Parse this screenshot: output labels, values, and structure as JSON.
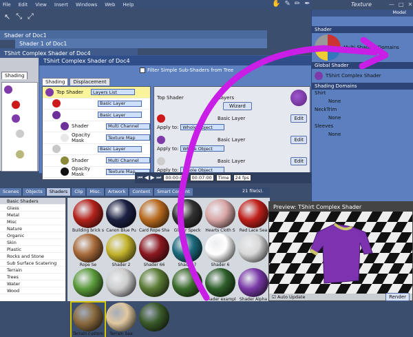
{
  "menu": [
    "File",
    "Edit",
    "View",
    "Insert",
    "Windows",
    "Web",
    "Help"
  ],
  "texture_label": "Texture",
  "model_label": "Model",
  "windows": {
    "doc1": "Shader of Doc1",
    "doc1_sub": "Shader 1 of Doc1",
    "tshirt_bg": "TShirt Complex Shader of Doc4",
    "main_title": "TShirt Complex Shader of Doc4",
    "left_tab": "Shading"
  },
  "filter_label": "Filter Simple Sub-Shaders from Tree",
  "tabs": [
    "Shading",
    "Displacement"
  ],
  "tree_rows": [
    {
      "label": "Top Shader",
      "dd": "Layers List",
      "color": "#7e3aa8",
      "selected": true
    },
    {
      "label": "",
      "dd": "Basic Layer",
      "color": "#cc1a1a"
    },
    {
      "label": "",
      "dd": "Basic Layer",
      "color": "#6e2f9a"
    },
    {
      "label": "Shader",
      "dd": "Multi Channel",
      "color": "#6e2f9a"
    },
    {
      "label": "Opacity Mask",
      "dd": "Texture Map",
      "color": "#e8e8e8"
    },
    {
      "label": "",
      "dd": "Basic Layer",
      "color": "#c8c8c8"
    },
    {
      "label": "Shader",
      "dd": "Multi Channel",
      "color": "#8a8a3a"
    },
    {
      "label": "Opacity Mask",
      "dd": "Texture Map",
      "color": "#111111"
    }
  ],
  "right_pane": {
    "top_shader": "Top Shader",
    "layers": "Layers",
    "wizard": "Wizard",
    "basic_layer": "Basic Layer",
    "apply_to": "Apply to:",
    "whole_object": "Whole Object",
    "edit": "Edit"
  },
  "timeline": {
    "start": "00:00:00",
    "end": "00:07:00",
    "time": "Time",
    "fps": "24 fps"
  },
  "content_tabs": [
    "Scenes",
    "Objects",
    "Shaders",
    "Clip",
    "Misc.",
    "Artwork",
    "Content",
    "Smart Content"
  ],
  "files_count": "21 file(s).",
  "categories": [
    "Basic Shaders",
    "Glass",
    "Metal",
    "Misc",
    "Nature",
    "Organic",
    "Skin",
    "Plastic",
    "Rocks and Stone",
    "Sub Surface Scatering",
    "Terrain",
    "Trees",
    "Water",
    "Wood"
  ],
  "tiles": [
    {
      "cap": "Building brick s",
      "color": "#b3221b"
    },
    {
      "cap": "Canon Blue Pu",
      "color": "#1c2142"
    },
    {
      "cap": "Card Rope Sha",
      "color": "#b86a1e"
    },
    {
      "cap": "Glitter Speck",
      "color": "#333"
    },
    {
      "cap": "Hearts Cloth S",
      "color": "#d9a6a6"
    },
    {
      "cap": "Red Lace Sea",
      "color": "#c0201b"
    },
    {
      "cap": "Rope Se",
      "color": "#a86a3a"
    },
    {
      "cap": "Shader 2",
      "color": "#c2b22b"
    },
    {
      "cap": "Shader 66",
      "color": "#8c1820"
    },
    {
      "cap": "Shader 7",
      "color": "#1c6a7c"
    },
    {
      "cap": "Shader 6",
      "color": "#ffffff"
    },
    {
      "cap": "",
      "color": "#d8d8d8"
    },
    {
      "cap": "",
      "color": "#5a9a3a"
    },
    {
      "cap": "",
      "color": "#ccc"
    },
    {
      "cap": "",
      "color": "#5b7a34"
    },
    {
      "cap": "",
      "color": "#3a6a2a"
    },
    {
      "cap": "Shader exampl",
      "color": "#2e5f2a"
    },
    {
      "cap": "Shader Alpha",
      "color": "#7a3aa8"
    },
    {
      "cap": "Terrain custom",
      "color": "#8a6a3e"
    },
    {
      "cap": "Terrain Sea",
      "color": "#e0c8a0"
    },
    {
      "cap": "",
      "color": "#3a5a2a"
    }
  ],
  "right_panel": {
    "shader_head": "Shader",
    "multi_domains": "Multi Shading Domains",
    "global_head": "Global Shader",
    "global_name": "TShirt Complex Shader",
    "domains_head": "Shading Domains",
    "domains": [
      {
        "name": "Shirt",
        "value": "None"
      },
      {
        "name": "NeckTrim",
        "value": "None"
      },
      {
        "name": "Sleeves",
        "value": "None"
      }
    ]
  },
  "preview": {
    "title": "Preview: TShirt Complex Shader",
    "auto_update": "Auto Update",
    "render": "Render"
  }
}
